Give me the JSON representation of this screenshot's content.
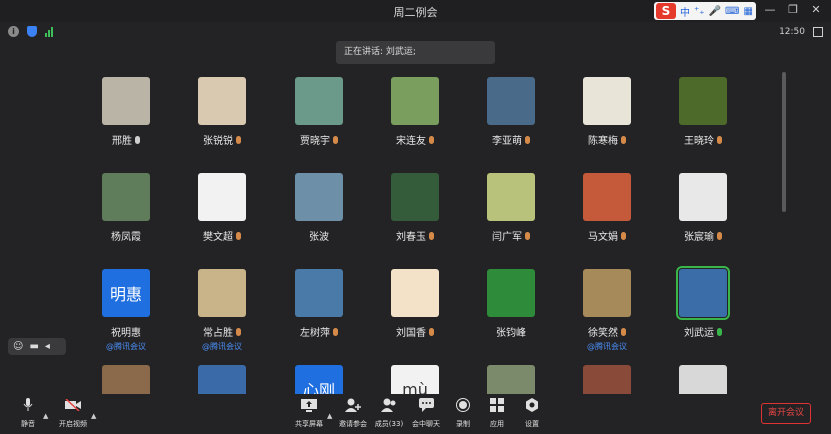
{
  "window": {
    "title": "周二例会",
    "controls": [
      "—",
      "❐",
      "✕"
    ]
  },
  "ime": {
    "logo": "S",
    "items": [
      "中",
      "⁺₊",
      "🎤",
      "⌨",
      "▦"
    ]
  },
  "status": {
    "info": "i",
    "clock": "12:50"
  },
  "speaking_banner": "正在讲话: 刘武运;",
  "participants": [
    {
      "name": "邢胜",
      "mic": "on",
      "sub": "",
      "thumb": "#b9b4a6"
    },
    {
      "name": "张锐锐",
      "mic": "muted",
      "sub": "",
      "thumb": "#d8c9b0"
    },
    {
      "name": "贾晓宇",
      "mic": "muted",
      "sub": "",
      "thumb": "#6c9a8a"
    },
    {
      "name": "宋连友",
      "mic": "muted",
      "sub": "",
      "thumb": "#7a9e5e"
    },
    {
      "name": "李亚萌",
      "mic": "muted",
      "sub": "",
      "thumb": "#4a6a8a"
    },
    {
      "name": "陈寒梅",
      "mic": "muted",
      "sub": "",
      "thumb": "#e9e4d8"
    },
    {
      "name": "王晓玲",
      "mic": "muted",
      "sub": "",
      "thumb": "#4d6a2a"
    },
    {
      "name": "杨凤霞",
      "mic": "none",
      "sub": "",
      "thumb": "#5f7d5a"
    },
    {
      "name": "樊文超",
      "mic": "muted",
      "sub": "",
      "thumb": "#f2f2f2"
    },
    {
      "name": "张波",
      "mic": "none",
      "sub": "",
      "thumb": "#6d8fa8"
    },
    {
      "name": "刘春玉",
      "mic": "muted",
      "sub": "",
      "thumb": "#355c3a"
    },
    {
      "name": "闫广军",
      "mic": "muted",
      "sub": "",
      "thumb": "#b9c27a"
    },
    {
      "name": "马文娟",
      "mic": "muted",
      "sub": "",
      "thumb": "#c45a3a"
    },
    {
      "name": "张宸瑜",
      "mic": "muted",
      "sub": "",
      "thumb": "#e8e8e8"
    },
    {
      "name": "祝明惠",
      "mic": "none",
      "sub": "@腾讯会议",
      "thumb": "#1f6fe0",
      "text": "明惠"
    },
    {
      "name": "常占胜",
      "mic": "muted",
      "sub": "@腾讯会议",
      "thumb": "#c9b48a"
    },
    {
      "name": "左树萍",
      "mic": "muted",
      "sub": "",
      "thumb": "#4a7aa8"
    },
    {
      "name": "刘国香",
      "mic": "muted",
      "sub": "",
      "thumb": "#f3e2c7"
    },
    {
      "name": "张钧峰",
      "mic": "none",
      "sub": "",
      "thumb": "#2e8b3a"
    },
    {
      "name": "徐笑然",
      "mic": "muted",
      "sub": "@腾讯会议",
      "thumb": "#a68a5a"
    },
    {
      "name": "刘武运",
      "mic": "green",
      "sub": "",
      "thumb": "#3b6ea8",
      "active": true
    },
    {
      "name": "",
      "mic": "none",
      "sub": "",
      "thumb": "#8a6a4a"
    },
    {
      "name": "",
      "mic": "none",
      "sub": "",
      "thumb": "#3a6aa8"
    },
    {
      "name": "",
      "mic": "none",
      "sub": "",
      "thumb": "#1f6fe0",
      "text": "心刚"
    },
    {
      "name": "",
      "mic": "none",
      "sub": "",
      "thumb": "#f2f2f2",
      "text": "mù"
    },
    {
      "name": "",
      "mic": "none",
      "sub": "",
      "thumb": "#7a8a6a"
    },
    {
      "name": "",
      "mic": "none",
      "sub": "",
      "thumb": "#8a4a3a"
    },
    {
      "name": "",
      "mic": "none",
      "sub": "",
      "thumb": "#d8d8d8"
    }
  ],
  "reactions": [
    "☺",
    "▬",
    "◂"
  ],
  "toolbar": {
    "mute": "静音",
    "video": "开启视频",
    "share": "共享屏幕",
    "invite": "邀请参会",
    "members": "成员(33)",
    "chat": "会中聊天",
    "record": "录制",
    "apps": "应用",
    "settings": "设置",
    "leave": "离开会议"
  }
}
